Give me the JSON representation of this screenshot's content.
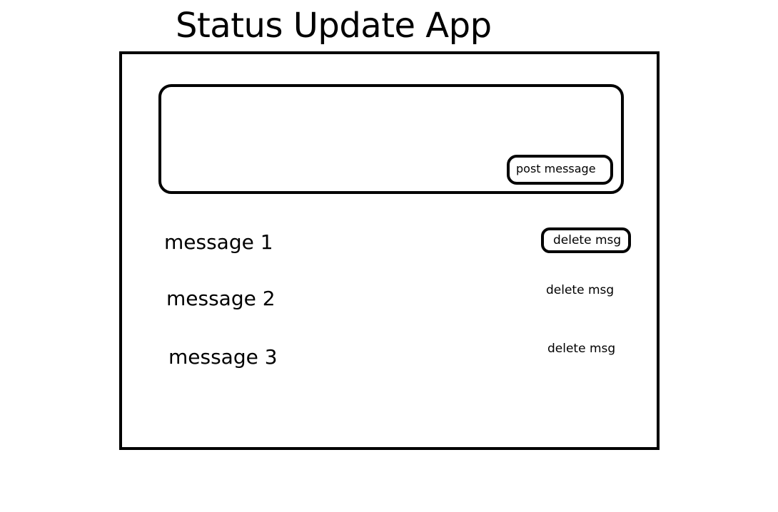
{
  "app": {
    "title": "Status Update App"
  },
  "compose": {
    "input_value": "",
    "input_placeholder": "",
    "post_label": "post message"
  },
  "messages": [
    {
      "text": "message 1",
      "delete_label": "delete msg"
    },
    {
      "text": "message 2",
      "delete_label": "delete msg"
    },
    {
      "text": "message 3",
      "delete_label": "delete msg"
    }
  ],
  "colors": {
    "stroke": "#000000",
    "background": "#ffffff"
  }
}
